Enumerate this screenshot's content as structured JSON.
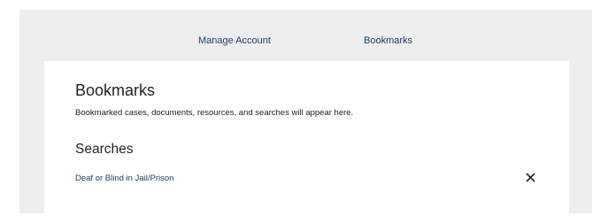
{
  "nav": {
    "manage_account": "Manage Account",
    "bookmarks": "Bookmarks"
  },
  "card": {
    "title": "Bookmarks",
    "description": "Bookmarked cases, documents, resources, and searches will appear here.",
    "searches_heading": "Searches",
    "saved_searches": [
      {
        "label": "Deaf or Blind in Jail/Prison",
        "remove_icon": "close-icon"
      }
    ]
  },
  "colors": {
    "page_background": "#eeeeef",
    "card_background": "#ffffff",
    "link": "#1f3a6b",
    "text": "#222222"
  }
}
